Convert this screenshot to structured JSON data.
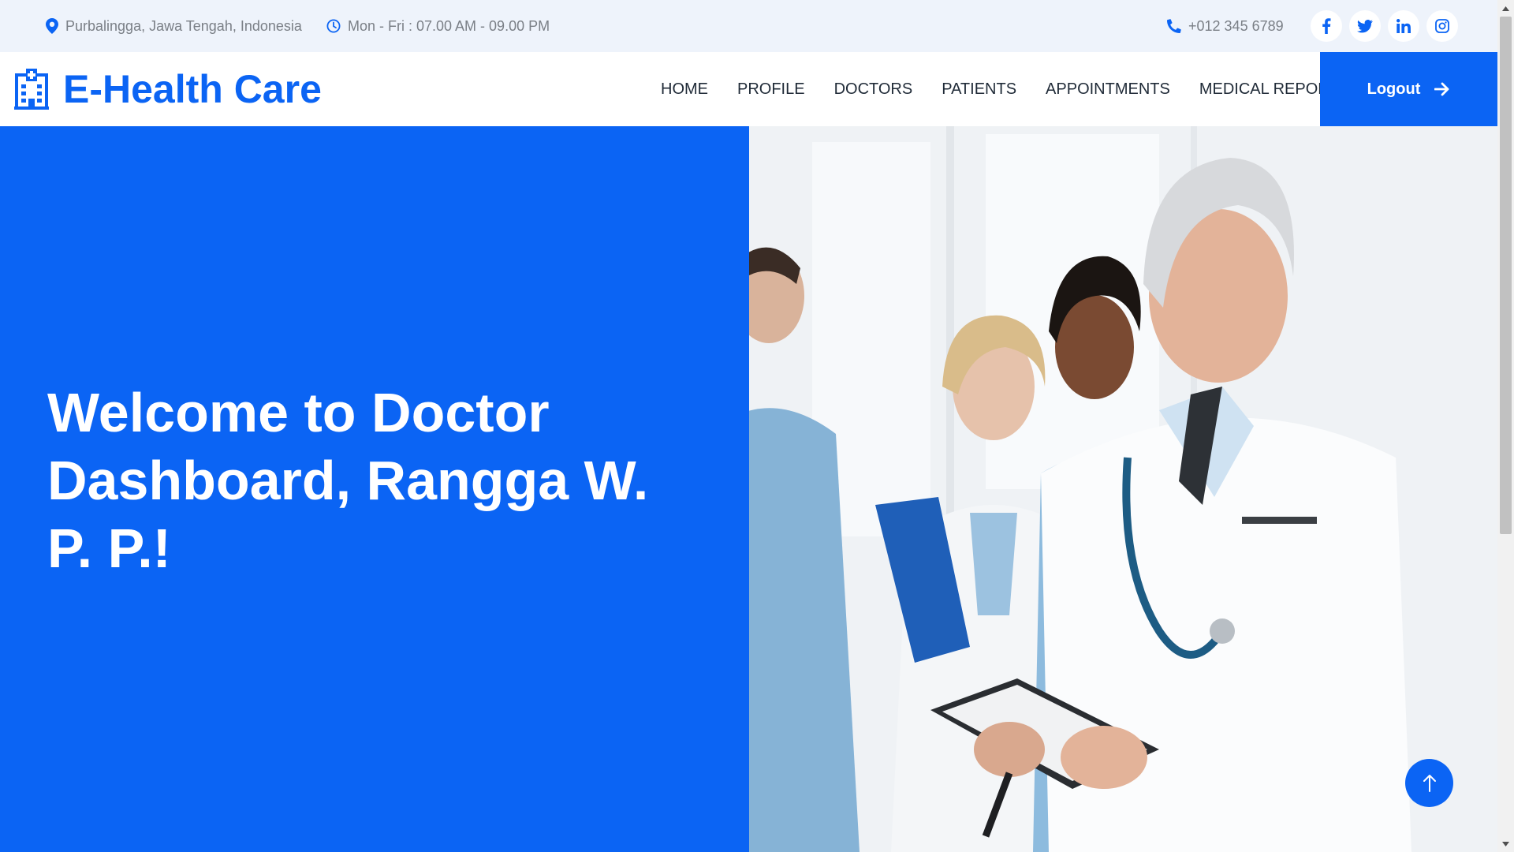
{
  "topbar": {
    "address": "Purbalingga, Jawa Tengah, Indonesia",
    "hours": "Mon - Fri : 07.00 AM - 09.00 PM",
    "phone": "+012 345 6789",
    "socials": [
      "facebook-icon",
      "twitter-icon",
      "linkedin-icon",
      "instagram-icon"
    ]
  },
  "brand": {
    "title": "E-Health Care",
    "icon": "hospital-icon"
  },
  "nav": {
    "items": [
      "HOME",
      "PROFILE",
      "DOCTORS",
      "PATIENTS",
      "APPOINTMENTS",
      "MEDICAL REPORTS"
    ],
    "logout_label": "Logout"
  },
  "hero": {
    "title": "Welcome to Doctor Dashboard, Rangga W. P. P.!"
  },
  "colors": {
    "accent": "#0b64f4",
    "topbar_bg": "#eef3fb",
    "nav_text": "#1f2a37",
    "muted_text": "#7a7f86"
  }
}
